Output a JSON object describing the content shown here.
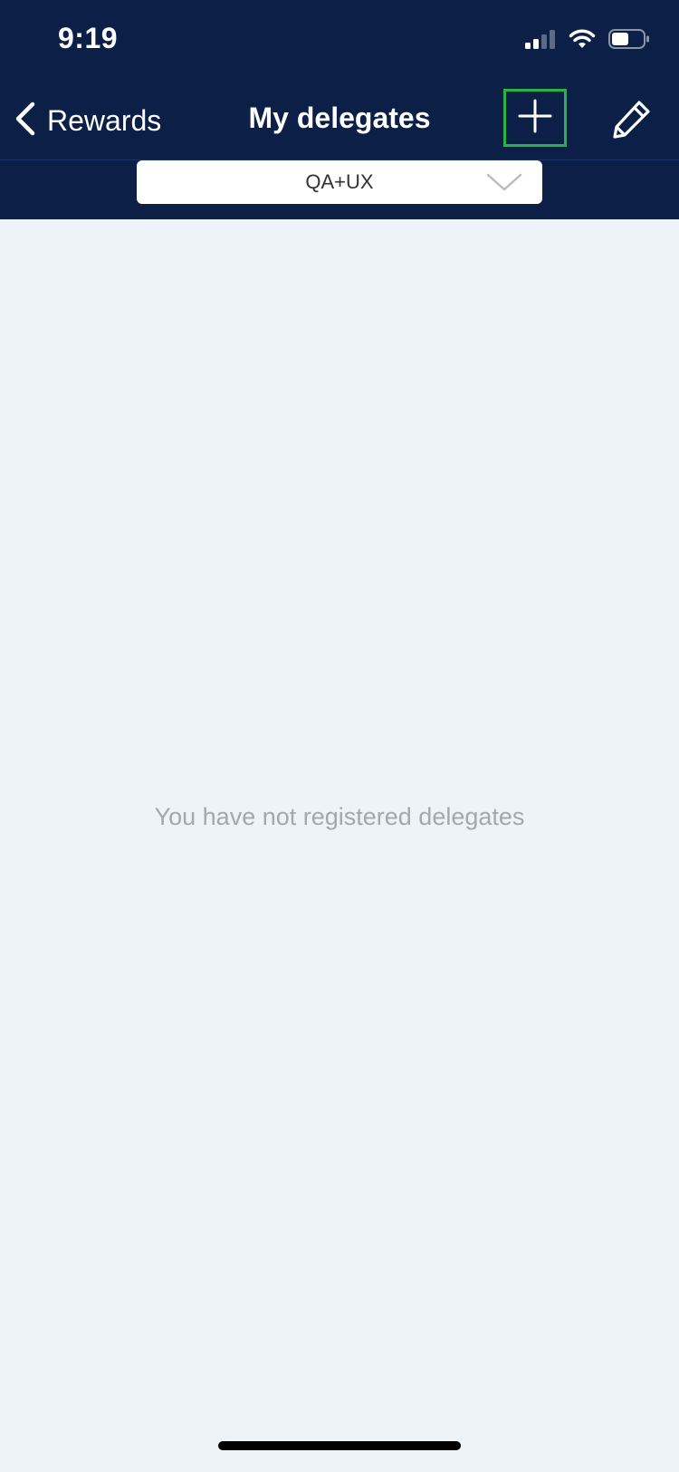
{
  "status_bar": {
    "time": "9:19"
  },
  "nav": {
    "back_label": "Rewards",
    "title": "My delegates"
  },
  "selector": {
    "value": "QA+UX"
  },
  "main": {
    "empty_message": "You have not registered delegates"
  },
  "colors": {
    "header_bg": "#0b1f47",
    "page_bg": "#eef3fa",
    "highlight": "#27b34a",
    "empty_text": "#a4a8ad"
  },
  "icons": {
    "back": "chevron-left-icon",
    "add": "plus-icon",
    "edit": "pencil-icon",
    "dropdown": "chevron-down-icon",
    "signal": "cellular-signal-icon",
    "wifi": "wifi-icon",
    "battery": "battery-icon"
  }
}
